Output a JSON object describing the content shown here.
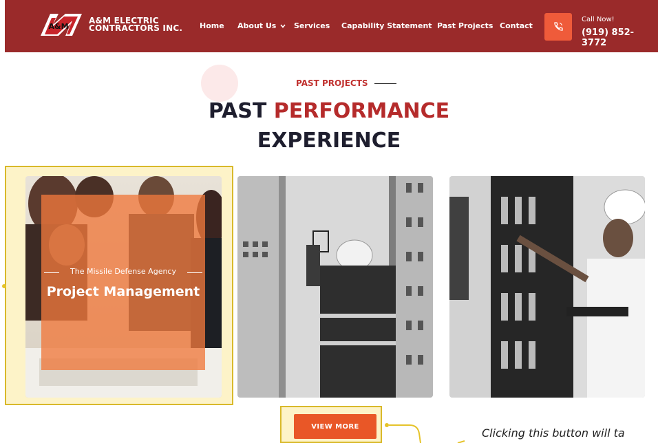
{
  "brand": {
    "line1": "A&M ELECTRIC",
    "line2": "CONTRACTORS INC.",
    "mark": "A&M"
  },
  "nav": {
    "home": "Home",
    "about": "About Us",
    "services": "Services",
    "capability": "Capability Statement",
    "projects": "Past Projects",
    "contact": "Contact"
  },
  "call": {
    "label": "Call Now!",
    "phone": "(919) 852-3772",
    "icon": "phone-icon"
  },
  "section": {
    "eyebrow": "PAST PROJECTS",
    "title_a": "PAST ",
    "title_b": "PERFORMANCE",
    "title_c": "EXPERIENCE"
  },
  "cards": [
    {
      "subtitle": "The Missile Defense Agency",
      "title": "Project Management"
    }
  ],
  "view_more": "VIEW MORE",
  "annotation": "Clicking this button will ta",
  "colors": {
    "header": "#9a2a2a",
    "accent": "#e95727",
    "highlight": "#d9b92a",
    "title_red": "#b52b2b"
  }
}
